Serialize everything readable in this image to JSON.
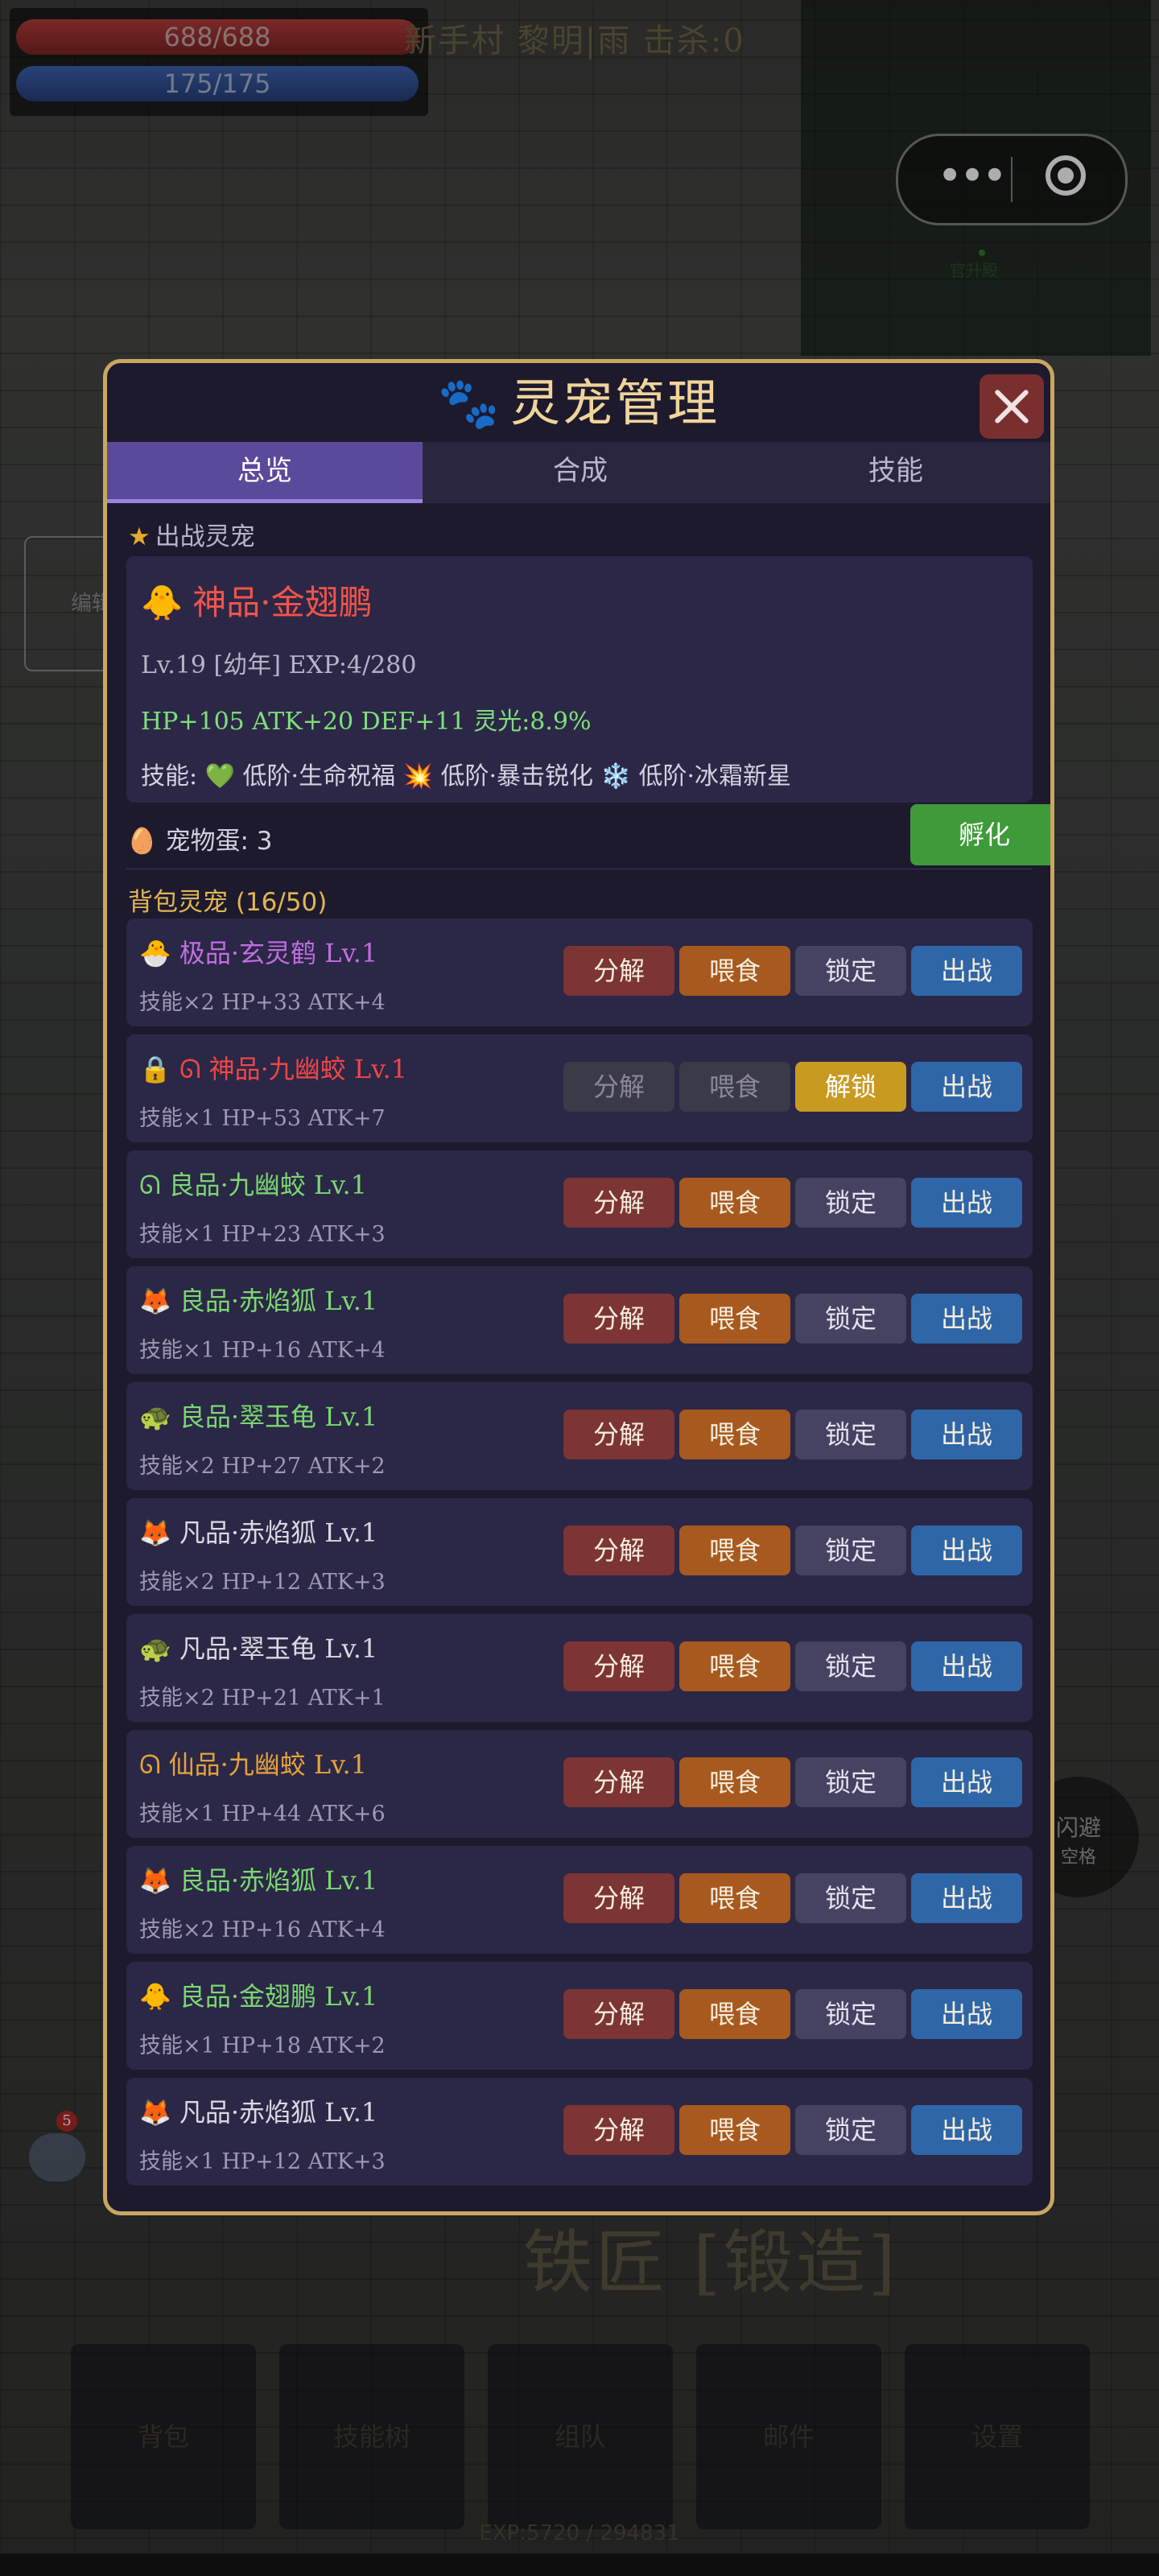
{
  "hud": {
    "hp": "688/688",
    "mp": "175/175",
    "top_info": "新手村  黎明|雨  击杀:0"
  },
  "minimap": {
    "label": "官升殿"
  },
  "capsule": {
    "more": "•••"
  },
  "edit_label": "编辑",
  "dodge": {
    "label": "闪避",
    "key": "空格"
  },
  "chat_badge": "5",
  "blacksmith": "铁匠 [锻造]",
  "bottom_buttons": [
    "背包",
    "技能树",
    "组队",
    "邮件",
    "设置"
  ],
  "exp_text": "EXP:5720 / 294831",
  "modal": {
    "title": "灵宠管理",
    "tabs": [
      "总览",
      "合成",
      "技能"
    ],
    "active_section_label": "出战灵宠",
    "active_pet": {
      "icon": "🐥",
      "name": "神品·金翅鹏",
      "level_line": "Lv.19  [幼年]  EXP:4/280",
      "stats_line": "HP+105  ATK+20  DEF+11  灵光:8.9%",
      "skills_line": "技能: 💚 低阶·生命祝福 💥 低阶·暴击锐化 ❄️ 低阶·冰霜新星"
    },
    "eggs_label": "宠物蛋: 3",
    "hatch_label": "孵化",
    "bag_label": "背包灵宠 (16/50)",
    "buttons": {
      "decompose": "分解",
      "feed": "喂食",
      "lock": "锁定",
      "unlock": "解锁",
      "deploy": "出战"
    },
    "pets": [
      {
        "icon": "🐣",
        "name": "极品·玄灵鹤 Lv.1",
        "stats": "技能×2  HP+33 ATK+4",
        "quality": "ext",
        "locked": false
      },
      {
        "icon": "🔒 ᘏ",
        "name": "神品·九幽蛟 Lv.1",
        "stats": "技能×1  HP+53 ATK+7",
        "quality": "god",
        "locked": true
      },
      {
        "icon": "ᘏ",
        "name": "良品·九幽蛟 Lv.1",
        "stats": "技能×1  HP+23 ATK+3",
        "quality": "good",
        "locked": false
      },
      {
        "icon": "🦊",
        "name": "良品·赤焰狐 Lv.1",
        "stats": "技能×1  HP+16 ATK+4",
        "quality": "good",
        "locked": false
      },
      {
        "icon": "🐢",
        "name": "良品·翠玉龟 Lv.1",
        "stats": "技能×2  HP+27 ATK+2",
        "quality": "good",
        "locked": false
      },
      {
        "icon": "🦊",
        "name": "凡品·赤焰狐 Lv.1",
        "stats": "技能×2  HP+12 ATK+3",
        "quality": "com",
        "locked": false
      },
      {
        "icon": "🐢",
        "name": "凡品·翠玉龟 Lv.1",
        "stats": "技能×2  HP+21 ATK+1",
        "quality": "com",
        "locked": false
      },
      {
        "icon": "ᘏ",
        "name": "仙品·九幽蛟 Lv.1",
        "stats": "技能×1  HP+44 ATK+6",
        "quality": "imm",
        "locked": false
      },
      {
        "icon": "🦊",
        "name": "良品·赤焰狐 Lv.1",
        "stats": "技能×2  HP+16 ATK+4",
        "quality": "good",
        "locked": false
      },
      {
        "icon": "🐥",
        "name": "良品·金翅鹏 Lv.1",
        "stats": "技能×1  HP+18 ATK+2",
        "quality": "good",
        "locked": false
      },
      {
        "icon": "🦊",
        "name": "凡品·赤焰狐 Lv.1",
        "stats": "技能×1  HP+12 ATK+3",
        "quality": "com",
        "locked": false
      }
    ]
  },
  "colors": {
    "gold_border": "#c9a661",
    "tab_active": "#5b4a9a",
    "hatch": "#3f9b3a",
    "decompose": "#7c3434",
    "feed": "#a7591f",
    "lock": "#454262",
    "deploy": "#2e66a8",
    "unlock": "#c99a20"
  }
}
